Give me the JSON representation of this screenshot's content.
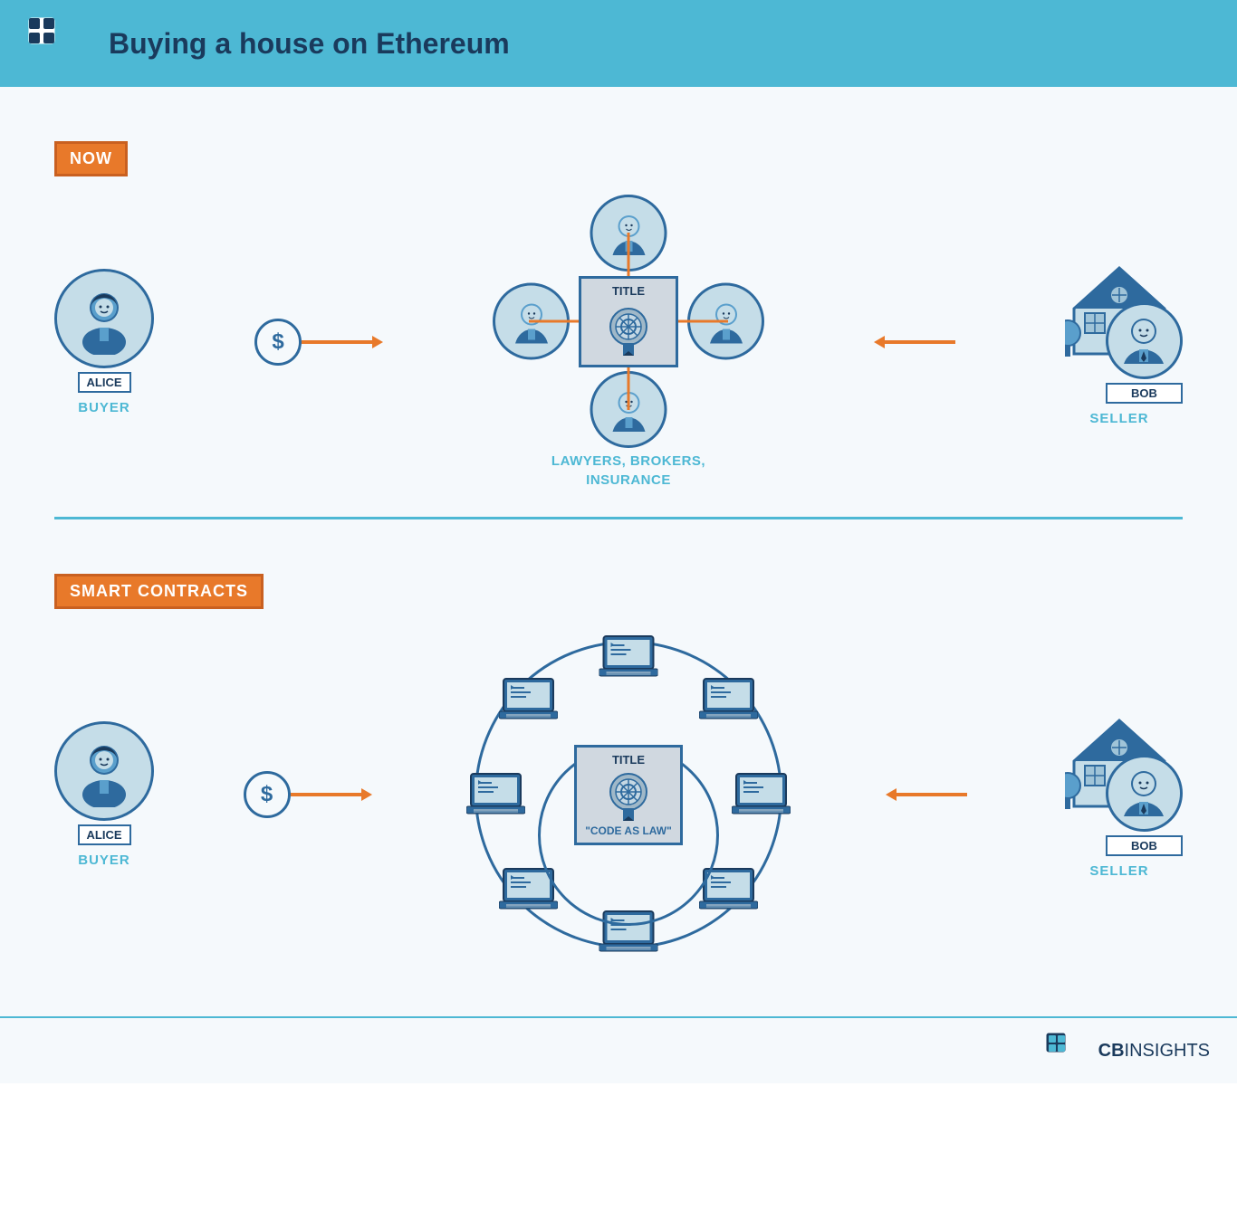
{
  "header": {
    "title": "Buying a house on Ethereum"
  },
  "now_section": {
    "badge": "NOW",
    "buyer_name": "ALICE",
    "buyer_role": "BUYER",
    "seller_name": "BOB",
    "seller_role": "SELLER",
    "middle_label1": "LAWYERS, BROKERS,",
    "middle_label2": "INSURANCE",
    "title_label": "TITLE"
  },
  "sc_section": {
    "badge": "SMART CONTRACTS",
    "buyer_name": "ALICE",
    "buyer_role": "BUYER",
    "seller_name": "BOB",
    "seller_role": "SELLER",
    "title_label": "TITLE",
    "code_law": "\"CODE AS LAW\""
  },
  "footer": {
    "logo_bold": "CB",
    "logo_light": "INSIGHTS"
  }
}
